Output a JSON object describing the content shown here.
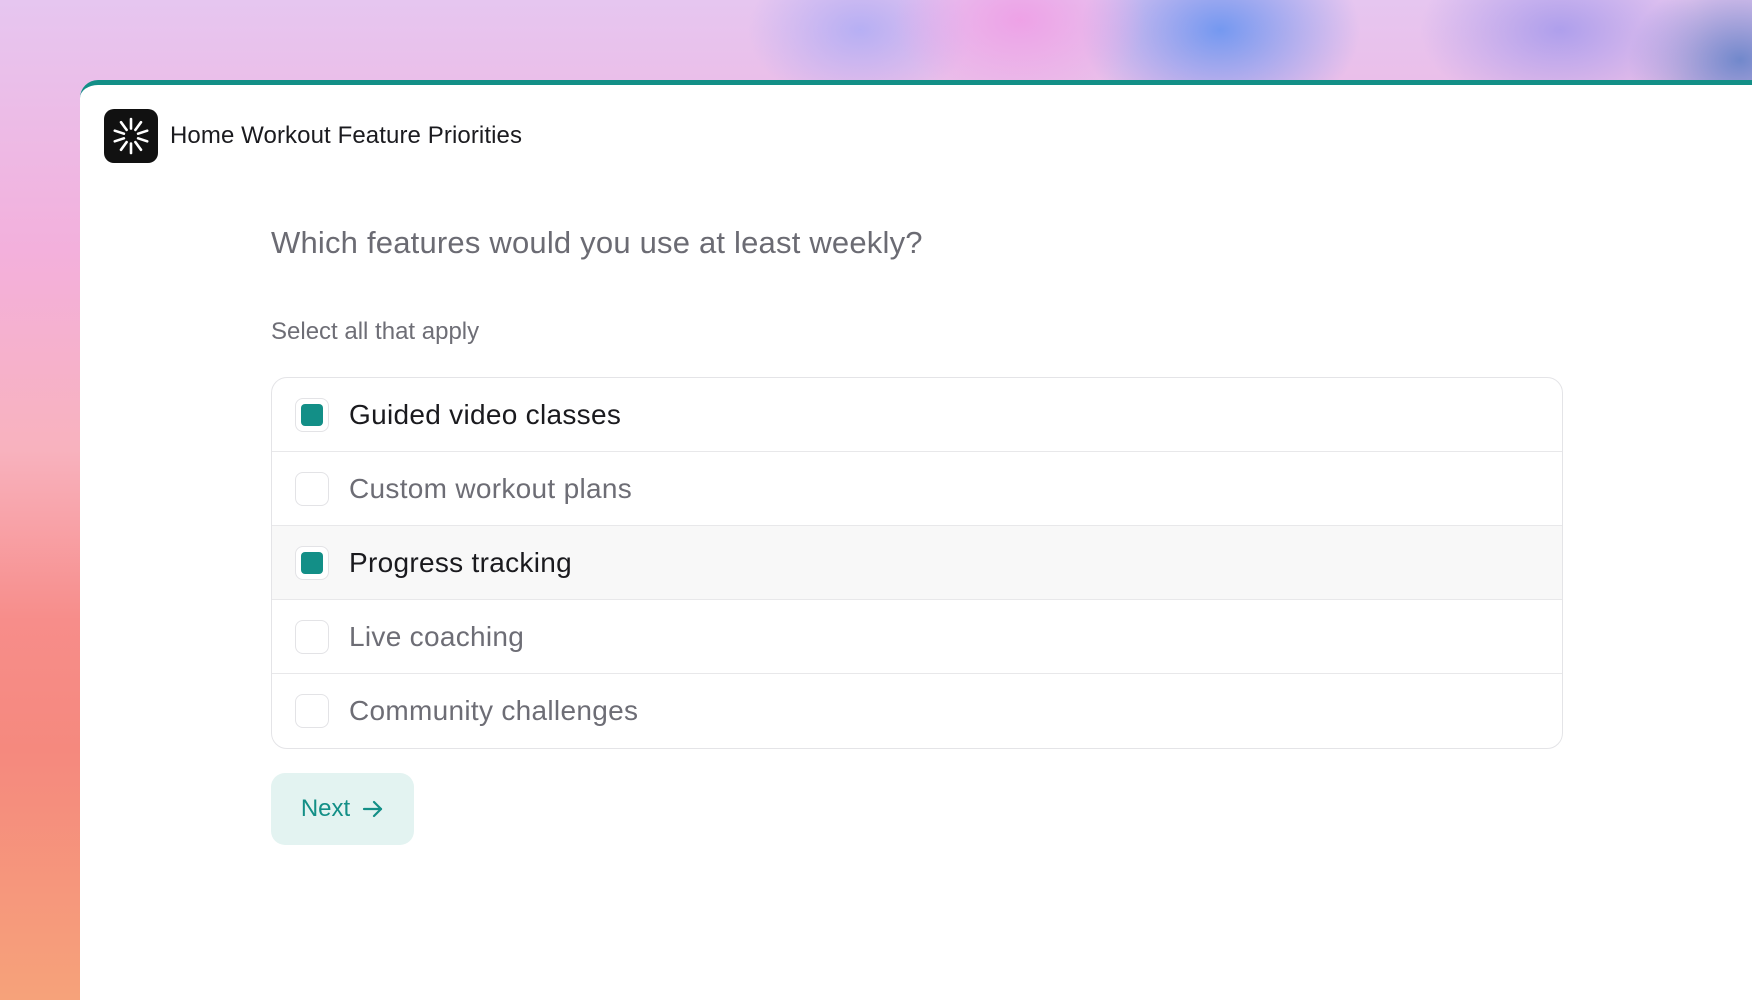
{
  "app": {
    "title": "Home Workout Feature Priorities"
  },
  "question": {
    "text": "Which features would you use at least weekly?",
    "hint": "Select all that apply"
  },
  "options": [
    {
      "label": "Guided video classes",
      "checked": true
    },
    {
      "label": "Custom workout plans",
      "checked": false
    },
    {
      "label": "Progress tracking",
      "checked": true
    },
    {
      "label": "Live coaching",
      "checked": false
    },
    {
      "label": "Community challenges",
      "checked": false
    }
  ],
  "actions": {
    "next_label": "Next"
  },
  "icons": {
    "logo": "sunburst-logo-icon",
    "next": "arrow-right-icon"
  },
  "colors": {
    "accent": "#138f87",
    "button_bg": "#e3f3f1"
  }
}
